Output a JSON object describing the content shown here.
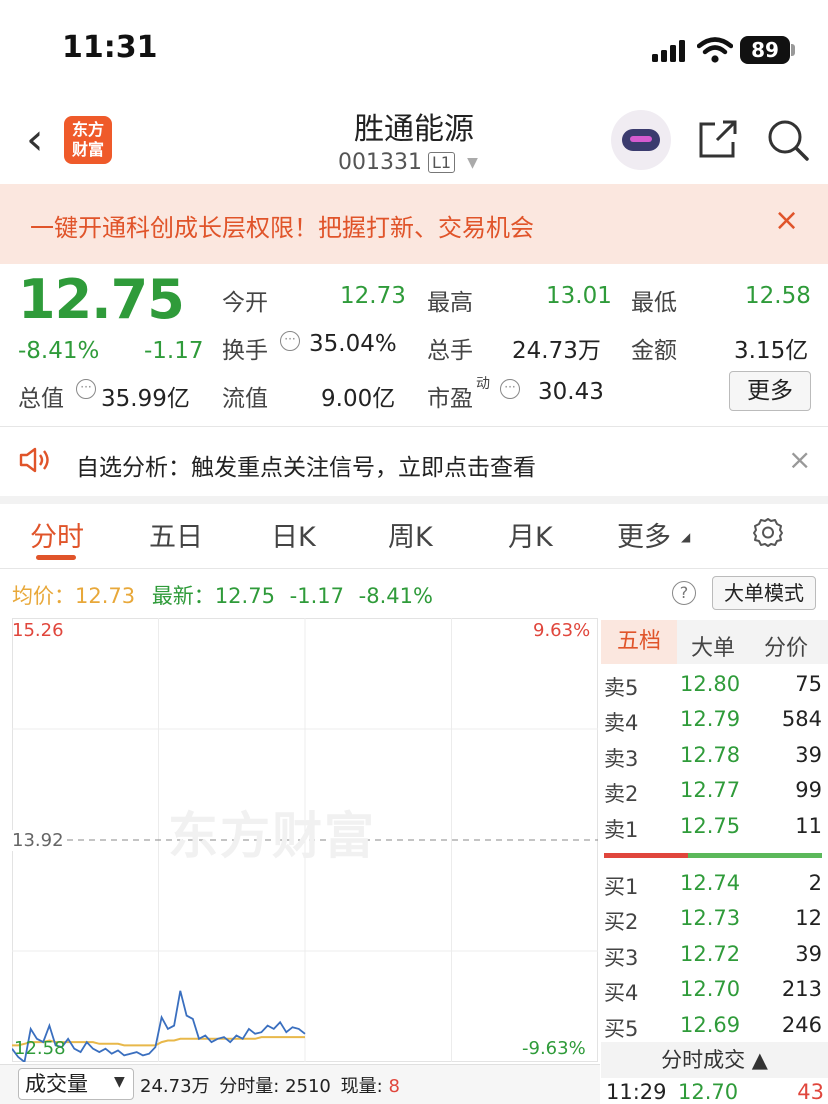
{
  "status_bar": {
    "time": "11:31",
    "battery": "89",
    "icons": [
      "signal-icon",
      "wifi-icon",
      "battery-icon"
    ]
  },
  "header": {
    "back": "‹",
    "logo_line1": "东方",
    "logo_line2": "财富",
    "stock_name": "胜通能源",
    "stock_code": "001331",
    "level": "L1"
  },
  "banner": {
    "text": "一键开通科创成长层权限！把握打新、交易机会",
    "close": "×"
  },
  "quote": {
    "price": "12.75",
    "change_pct": "-8.41%",
    "change": "-1.17",
    "open_label": "今开",
    "open": "12.73",
    "high_label": "最高",
    "high": "13.01",
    "low_label": "最低",
    "low": "12.58",
    "turnover_label": "换手",
    "turnover": "35.04%",
    "volume_label": "总手",
    "volume": "24.73万",
    "amount_label": "金额",
    "amount": "3.15亿",
    "mktcap_label": "总值",
    "mktcap": "35.99亿",
    "float_label": "流值",
    "float": "9.00亿",
    "pe_label": "市盈",
    "pe_sup": "动",
    "pe": "30.43",
    "more_button": "更多"
  },
  "notice": {
    "text": "自选分析：触发重点关注信号，立即点击查看",
    "close": "×"
  },
  "tabs": [
    {
      "label": "分时",
      "active": true
    },
    {
      "label": "五日"
    },
    {
      "label": "日K"
    },
    {
      "label": "周K"
    },
    {
      "label": "月K"
    },
    {
      "label": "更多"
    }
  ],
  "info_row": {
    "avg_label": "均价：",
    "avg": "12.73",
    "latest_label": "最新：",
    "latest": "12.75",
    "latest_chg": "-1.17",
    "latest_pct": "-8.41%",
    "help": "?",
    "big_order_button": "大单模式"
  },
  "chart_labels": {
    "top": "15.26",
    "top_pct": "9.63%",
    "mid": "13.92",
    "low": "12.58",
    "low_pct": "-9.63%",
    "watermark": "东方财富"
  },
  "chart_data": {
    "type": "line",
    "ylim": [
      12.58,
      15.26
    ],
    "reference": 13.92,
    "x_points": 48,
    "series": [
      {
        "name": "price",
        "color": "#3a6fbf",
        "values": [
          12.66,
          12.61,
          12.58,
          12.78,
          12.72,
          12.7,
          12.8,
          12.68,
          12.67,
          12.72,
          12.66,
          12.64,
          12.7,
          12.66,
          12.64,
          12.66,
          12.63,
          12.65,
          12.62,
          12.63,
          12.64,
          12.62,
          12.63,
          12.67,
          12.85,
          12.78,
          12.8,
          13.01,
          12.86,
          12.84,
          12.72,
          12.74,
          12.7,
          12.72,
          12.73,
          12.7,
          12.74,
          12.72,
          12.78,
          12.75,
          12.76,
          12.8,
          12.78,
          12.82,
          12.76,
          12.79,
          12.78,
          12.75
        ]
      },
      {
        "name": "avg",
        "color": "#e8b84a",
        "values": [
          12.68,
          12.68,
          12.69,
          12.7,
          12.7,
          12.7,
          12.71,
          12.7,
          12.7,
          12.7,
          12.7,
          12.7,
          12.7,
          12.7,
          12.69,
          12.69,
          12.69,
          12.69,
          12.68,
          12.68,
          12.68,
          12.68,
          12.68,
          12.68,
          12.7,
          12.71,
          12.71,
          12.72,
          12.72,
          12.72,
          12.72,
          12.72,
          12.72,
          12.72,
          12.72,
          12.72,
          12.72,
          12.72,
          12.72,
          12.72,
          12.73,
          12.73,
          12.73,
          12.73,
          12.73,
          12.73,
          12.73,
          12.73
        ]
      }
    ]
  },
  "volume_bar": {
    "select": "成交量",
    "total": "24.73万",
    "slice_label": "分时量:",
    "slice": "2510",
    "now_label": "现量:",
    "now": "8"
  },
  "order_book": {
    "tabs": [
      "五档",
      "大单",
      "分价"
    ],
    "asks": [
      {
        "label": "卖5",
        "price": "12.80",
        "vol": "75"
      },
      {
        "label": "卖4",
        "price": "12.79",
        "vol": "584"
      },
      {
        "label": "卖3",
        "price": "12.78",
        "vol": "39"
      },
      {
        "label": "卖2",
        "price": "12.77",
        "vol": "99"
      },
      {
        "label": "卖1",
        "price": "12.75",
        "vol": "11"
      }
    ],
    "bids": [
      {
        "label": "买1",
        "price": "12.74",
        "vol": "2"
      },
      {
        "label": "买2",
        "price": "12.73",
        "vol": "12"
      },
      {
        "label": "买3",
        "price": "12.72",
        "vol": "39"
      },
      {
        "label": "买4",
        "price": "12.70",
        "vol": "213"
      },
      {
        "label": "买5",
        "price": "12.69",
        "vol": "246"
      }
    ],
    "ticks_header": "分时成交 ▲",
    "tick": {
      "time": "11:29",
      "price": "12.70",
      "vol": "43"
    }
  }
}
